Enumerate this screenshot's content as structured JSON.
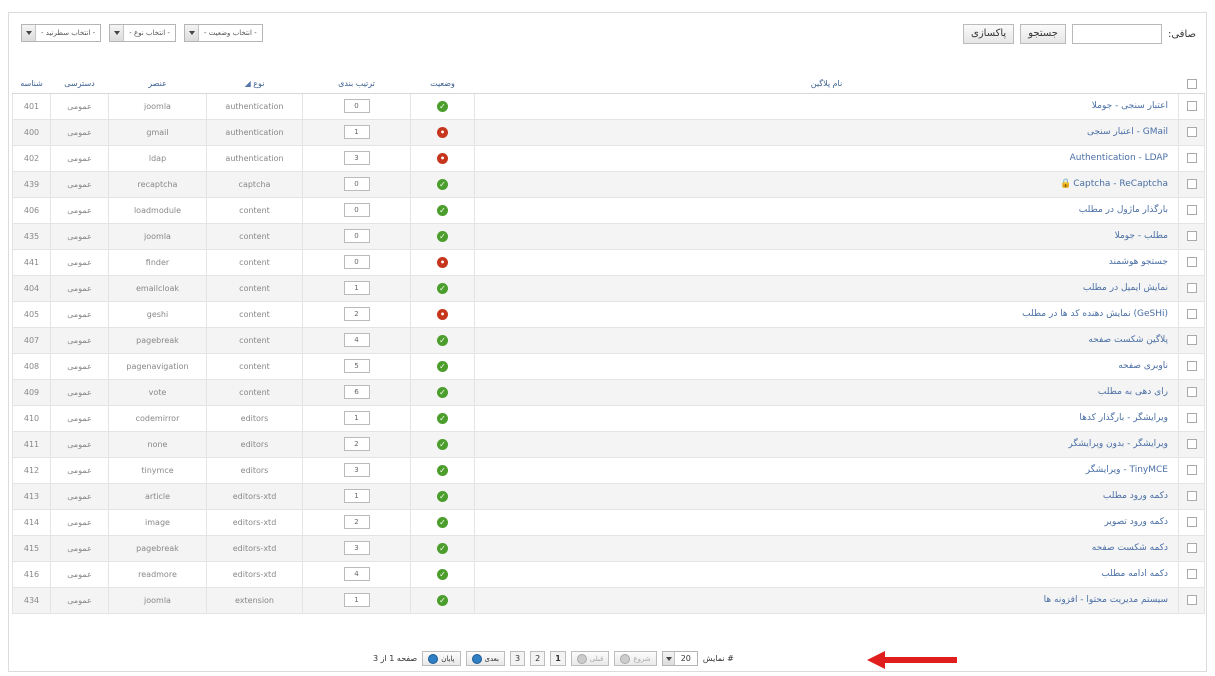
{
  "filter": {
    "label": "صافی:",
    "search_value": "",
    "search_button": "جستجو",
    "reset_button": "پاکسازی",
    "selects": [
      "- انتخاب سطرنید -",
      "- انتخاب نوع -",
      "- انتخاب وضعیت -"
    ]
  },
  "columns": {
    "name": "نام پلاگین",
    "status": "وضعیت",
    "ordering": "ترتیب بندی",
    "type": "نوع",
    "element": "عنصر",
    "access": "دسترسی",
    "id": "شناسه"
  },
  "rows": [
    {
      "name": "اعتبار سنجی - جوملا",
      "status": "on",
      "order": "0",
      "type": "authentication",
      "element": "joomla",
      "access": "عمومی",
      "id": "401"
    },
    {
      "name": "اعتبار سنجی - GMail",
      "status": "off",
      "order": "1",
      "type": "authentication",
      "element": "gmail",
      "access": "عمومی",
      "id": "400"
    },
    {
      "name": "Authentication - LDAP",
      "status": "off",
      "order": "3",
      "type": "authentication",
      "element": "ldap",
      "access": "عمومی",
      "id": "402"
    },
    {
      "name": "Captcha - ReCaptcha",
      "status": "on",
      "order": "0",
      "type": "captcha",
      "element": "recaptcha",
      "access": "عمومی",
      "id": "439",
      "locked": true
    },
    {
      "name": "بارگذار ماژول در مطلب",
      "status": "on",
      "order": "0",
      "type": "content",
      "element": "loadmodule",
      "access": "عمومی",
      "id": "406"
    },
    {
      "name": "مطلب - جوملا",
      "status": "on",
      "order": "0",
      "type": "content",
      "element": "joomla",
      "access": "عمومی",
      "id": "435"
    },
    {
      "name": "جستجو هوشمند",
      "status": "off",
      "order": "0",
      "type": "content",
      "element": "finder",
      "access": "عمومی",
      "id": "441"
    },
    {
      "name": "نمایش ایمیل در مطلب",
      "status": "on",
      "order": "1",
      "type": "content",
      "element": "emailcloak",
      "access": "عمومی",
      "id": "404"
    },
    {
      "name": "نمایش دهنده کد ها در مطلب (GeSHi)",
      "status": "off",
      "order": "2",
      "type": "content",
      "element": "geshi",
      "access": "عمومی",
      "id": "405"
    },
    {
      "name": "پلاگین شکست صفحه",
      "status": "on",
      "order": "4",
      "type": "content",
      "element": "pagebreak",
      "access": "عمومی",
      "id": "407"
    },
    {
      "name": "ناوبری صفحه",
      "status": "on",
      "order": "5",
      "type": "content",
      "element": "pagenavigation",
      "access": "عمومی",
      "id": "408"
    },
    {
      "name": "رای دهی به مطلب",
      "status": "on",
      "order": "6",
      "type": "content",
      "element": "vote",
      "access": "عمومی",
      "id": "409"
    },
    {
      "name": "ویرایشگر - بارگذار کدها",
      "status": "on",
      "order": "1",
      "type": "editors",
      "element": "codemirror",
      "access": "عمومی",
      "id": "410"
    },
    {
      "name": "ویرایشگر - بدون ویرایشگر",
      "status": "on",
      "order": "2",
      "type": "editors",
      "element": "none",
      "access": "عمومی",
      "id": "411"
    },
    {
      "name": "ویرایشگر - TinyMCE",
      "status": "on",
      "order": "3",
      "type": "editors",
      "element": "tinymce",
      "access": "عمومی",
      "id": "412"
    },
    {
      "name": "دکمه ورود مطلب",
      "status": "on",
      "order": "1",
      "type": "editors-xtd",
      "element": "article",
      "access": "عمومی",
      "id": "413"
    },
    {
      "name": "دکمه ورود تصویر",
      "status": "on",
      "order": "2",
      "type": "editors-xtd",
      "element": "image",
      "access": "عمومی",
      "id": "414"
    },
    {
      "name": "دکمه شکست صفحه",
      "status": "on",
      "order": "3",
      "type": "editors-xtd",
      "element": "pagebreak",
      "access": "عمومی",
      "id": "415"
    },
    {
      "name": "دکمه ادامه مطلب",
      "status": "on",
      "order": "4",
      "type": "editors-xtd",
      "element": "readmore",
      "access": "عمومی",
      "id": "416"
    },
    {
      "name": "سیستم مدیریت محتوا - افزونه ها",
      "status": "on",
      "order": "1",
      "type": "extension",
      "element": "joomla",
      "access": "عمومی",
      "id": "434"
    }
  ],
  "pagination": {
    "display_label": "نمایش #",
    "limit": "20",
    "start": "شروع",
    "prev": "قبلی",
    "pages": [
      "1",
      "2",
      "3"
    ],
    "current_page": "1",
    "next": "بعدی",
    "end": "پایان",
    "page_info": "صفحه 1 از 3"
  },
  "colors": {
    "enabled": "#4c9e2c",
    "disabled": "#c6361c",
    "link": "#4a6fa5",
    "arrow": "#e01e1e"
  },
  "icons": {
    "enabled": "check-circle-icon",
    "disabled": "x-circle-icon",
    "locked": "lock-icon",
    "sort": "sort-icon"
  }
}
